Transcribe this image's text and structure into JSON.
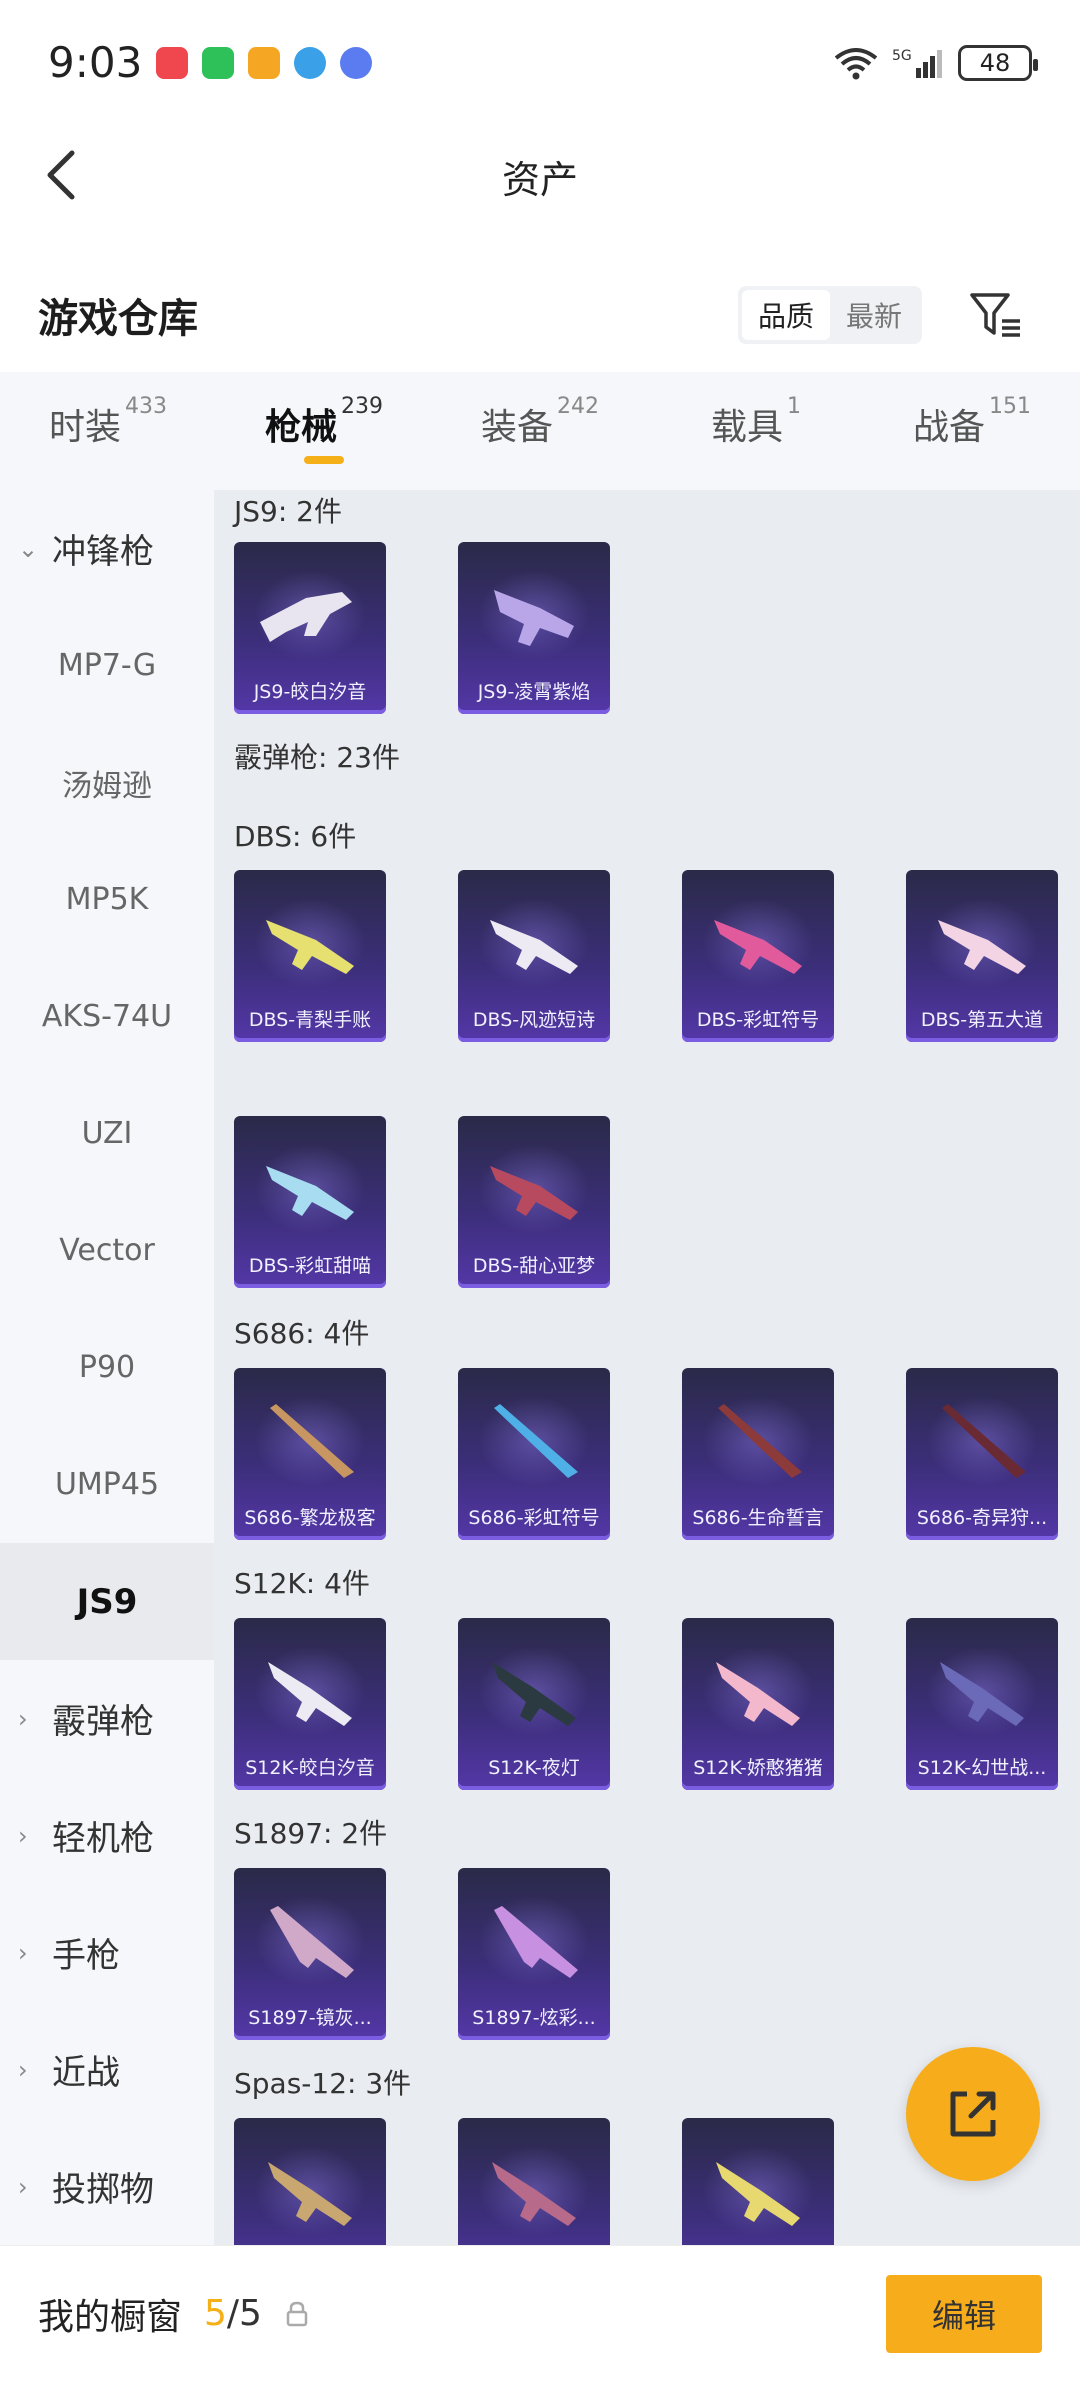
{
  "status_bar": {
    "time": "9:03",
    "network": "5G",
    "battery": "48"
  },
  "header": {
    "title": "资产"
  },
  "warehouse": {
    "title": "游戏仓库",
    "sort_options": [
      "品质",
      "最新"
    ],
    "active_sort": "品质"
  },
  "tabs": [
    {
      "label": "时装",
      "count": "433"
    },
    {
      "label": "枪械",
      "count": "239",
      "active": true
    },
    {
      "label": "装备",
      "count": "242"
    },
    {
      "label": "载具",
      "count": "1"
    },
    {
      "label": "战备",
      "count": "151"
    }
  ],
  "sidebar": {
    "items": [
      {
        "label": "冲锋枪",
        "type": "category",
        "expanded": true
      },
      {
        "label": "MP7-G"
      },
      {
        "label": "汤姆逊"
      },
      {
        "label": "MP5K"
      },
      {
        "label": "AKS-74U"
      },
      {
        "label": "UZI"
      },
      {
        "label": "Vector"
      },
      {
        "label": "P90"
      },
      {
        "label": "UMP45"
      },
      {
        "label": "JS9",
        "selected": true
      },
      {
        "label": "霰弹枪",
        "type": "category"
      },
      {
        "label": "轻机枪",
        "type": "category"
      },
      {
        "label": "手枪",
        "type": "category"
      },
      {
        "label": "近战",
        "type": "category"
      },
      {
        "label": "投掷物",
        "type": "category"
      }
    ]
  },
  "content": {
    "groups": [
      {
        "label": "JS9: 2件",
        "items": [
          "JS9-皎白汐音",
          "JS9-凌霄紫焰"
        ]
      },
      {
        "label": "霰弹枪: 23件",
        "items": []
      },
      {
        "label": "DBS: 6件",
        "items": [
          "DBS-青梨手账",
          "DBS-风迹短诗",
          "DBS-彩虹符号",
          "DBS-第五大道",
          "DBS-彩虹甜喵",
          "DBS-甜心亚梦"
        ]
      },
      {
        "label": "S686: 4件",
        "items": [
          "S686-繁龙极客",
          "S686-彩虹符号",
          "S686-生命誓言",
          "S686-奇异狩..."
        ]
      },
      {
        "label": "S12K: 4件",
        "items": [
          "S12K-皎白汐音",
          "S12K-夜灯",
          "S12K-娇憨猪猪",
          "S12K-幻世战..."
        ]
      },
      {
        "label": "S1897: 2件",
        "items": [
          "S1897-镜灰...",
          "S1897-炫彩..."
        ]
      },
      {
        "label": "Spas-12: 3件",
        "items": [
          "",
          "",
          ""
        ]
      }
    ]
  },
  "bottom_bar": {
    "showcase_label": "我的橱窗",
    "showcase_current": "5",
    "showcase_total": "/5",
    "edit_label": "编辑"
  },
  "colors": {
    "accent": "#f7ad1b",
    "card_bg": "#3b2e78"
  }
}
